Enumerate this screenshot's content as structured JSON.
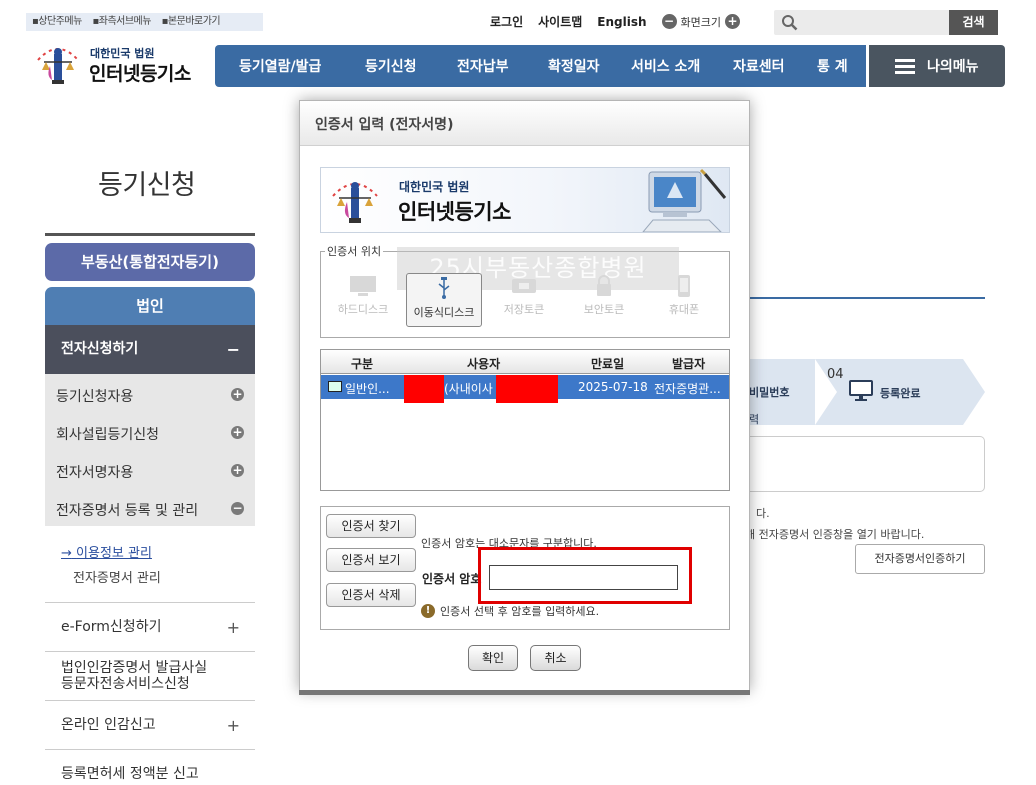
{
  "skip_links": [
    "상단주메뉴",
    "좌측서브메뉴",
    "본문바로가기"
  ],
  "util": {
    "login": "로그인",
    "sitemap": "사이트맵",
    "english": "English",
    "zoom_minus": "−",
    "zoom_label": "화면크기",
    "zoom_plus": "+"
  },
  "search": {
    "placeholder": "",
    "button": "검색"
  },
  "logo": {
    "line1": "대한민국 법원",
    "line2": "인터넷등기소"
  },
  "gnb": [
    "등기열람/발급",
    "등기신청",
    "전자납부",
    "확정일자",
    "서비스 소개",
    "자료센터",
    "통 계"
  ],
  "my_menu": "나의메뉴",
  "side": {
    "title": "등기신청",
    "btn_realestate": "부동산(통합전자등기)",
    "btn_corp": "법인",
    "selected": "전자신청하기",
    "selected_toggle": "−",
    "subitems": [
      "등기신청자용",
      "회사설립등기신청",
      "전자서명자용",
      "전자증명서 등록 및 관리"
    ],
    "subitem_toggles": [
      "+",
      "+",
      "+",
      "−"
    ],
    "depth3": [
      "이용정보 관리",
      "전자증명서 관리"
    ],
    "depth3_arrow": "→",
    "more": [
      {
        "label": "e-Form신청하기",
        "toggle": "+"
      },
      {
        "label": "법인인감증명서 발급사실\n등문자전송서비스신청",
        "toggle": ""
      },
      {
        "label": "온라인 인감신고",
        "toggle": "+"
      },
      {
        "label": "등록면허세 정액분 신고",
        "toggle": ""
      }
    ]
  },
  "steps": {
    "step3_label": "비밀번호",
    "step3_sub": "력",
    "step4_num": "04",
    "step4_label": "등록완료"
  },
  "right_text": {
    "line1": "다.",
    "line2": "해 전자증명서 인증창을 열기 바랍니다.",
    "button": "전자증명서인증하기"
  },
  "modal": {
    "title": "인증서 입력 (전자서명)",
    "banner_line1": "대한민국 법원",
    "banner_line2": "인터넷등기소",
    "location_legend": "인증서 위치",
    "watermark": "25시부동산종합병원",
    "locations": [
      "하드디스크",
      "이동식디스크",
      "저장토큰",
      "보안토큰",
      "휴대폰"
    ],
    "selected_location": "이동식디스크",
    "table": {
      "headers": [
        "구분",
        "사용자",
        "만료일",
        "발급자"
      ],
      "rows": [
        {
          "type": "일반인...",
          "user": "(사내이사",
          "expiry": "2025-07-18",
          "issuer": "전자증명관..."
        }
      ]
    },
    "buttons": {
      "find": "인증서 찾기",
      "view": "인증서 보기",
      "delete": "인증서 삭제"
    },
    "case_note": "인증서 암호는 대소문자를 구분합니다.",
    "password_label": "인증서 암호",
    "password_value": "",
    "warning_icon": "!",
    "warning": "인증서 선택 후 암호를 입력하세요.",
    "ok": "확인",
    "cancel": "취소"
  },
  "colors": {
    "gnb": "#3a6ba3",
    "my_menu": "#4a5560",
    "side_realestate": "#5c6aa8",
    "side_corp": "#4f7eb3",
    "side_selected": "#4b4f5c",
    "row_selected": "#3d78c9",
    "redaction": "#ff0000",
    "highlight_box": "#e00000"
  }
}
